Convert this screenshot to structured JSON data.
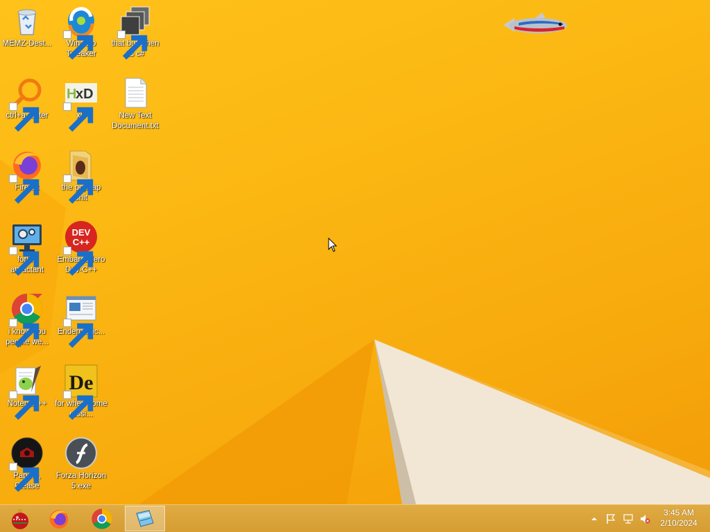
{
  "desktop": {
    "icons": [
      {
        "label": "MEMZ-Dest...",
        "icon": "recycle-bin-icon"
      },
      {
        "label": "Winaero Tweaker",
        "icon": "winaero-tweaker-icon"
      },
      {
        "label": "that but when its c#",
        "icon": "stacked-windows-icon"
      },
      {
        "label": "ctrl+a, enter",
        "icon": "magnifier-icon"
      },
      {
        "label": "xD",
        "icon": "hxd-icon"
      },
      {
        "label": "New Text Document.txt",
        "icon": "text-document-icon"
      },
      {
        "label": "Firefox",
        "icon": "firefox-icon"
      },
      {
        "label": "the popcap shit",
        "icon": "folder-icon"
      },
      {
        "label": "forkie attractant",
        "icon": "monitor-gears-icon"
      },
      {
        "label": "Embarcadero Dev-C++",
        "icon": "devcpp-icon"
      },
      {
        "label": "i know you people we...",
        "icon": "chrome-icon"
      },
      {
        "label": "Endermanc...",
        "icon": "window-app-icon"
      },
      {
        "label": "Notepad++",
        "icon": "notepadpp-icon"
      },
      {
        "label": "for when some russi...",
        "icon": "de-icon"
      },
      {
        "label": "Papers, Please",
        "icon": "papers-please-icon"
      },
      {
        "label": "Forza Horizon 5.exe",
        "icon": "flash-icon"
      }
    ],
    "devcpp_badge": "DEV C++",
    "hxd_badge": "xD",
    "de_badge": "De"
  },
  "taskbar": {
    "buttons": [
      {
        "icon": "start-ornament-icon"
      },
      {
        "icon": "firefox-icon"
      },
      {
        "icon": "chrome-icon"
      },
      {
        "icon": "notepad-icon",
        "active": true
      }
    ],
    "tray": [
      "show-hidden-icons-icon",
      "action-center-flag-icon",
      "network-icon",
      "volume-muted-icon"
    ],
    "clock": {
      "time": "3:45 AM",
      "date": "2/10/2024"
    }
  },
  "colors": {
    "wallpaper": "#fbb612",
    "taskbar": "#d89f35",
    "label_text": "#ffffff"
  }
}
